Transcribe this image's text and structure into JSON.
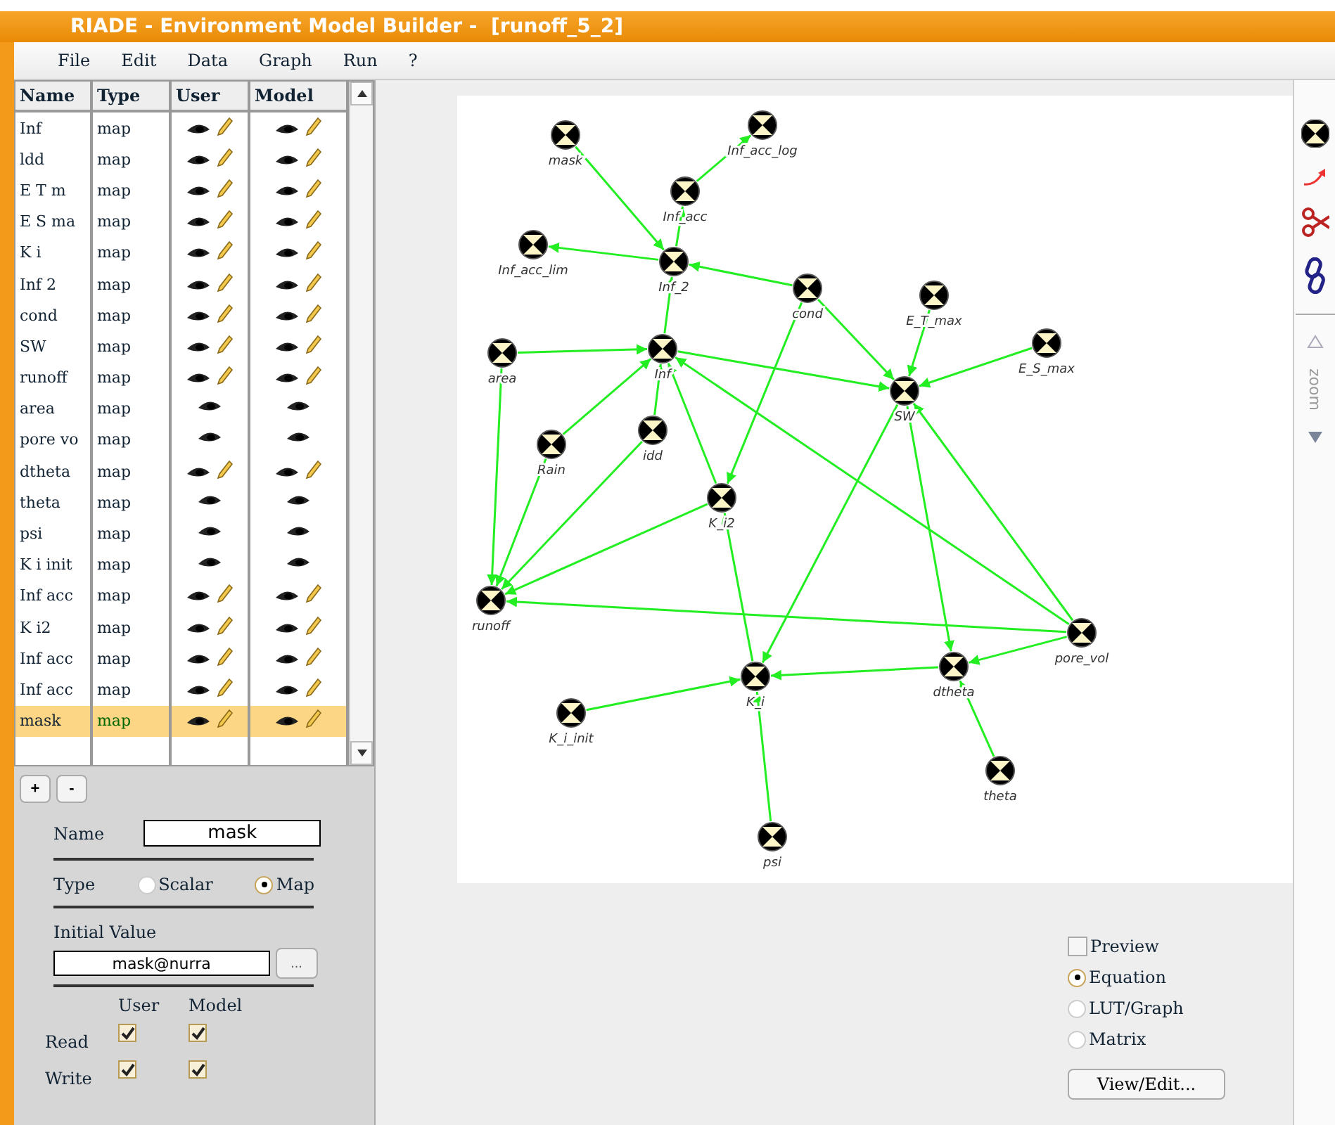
{
  "window": {
    "title": "RIADE - Environment Model Builder -  [runoff_5_2]"
  },
  "menu": [
    "File",
    "Edit",
    "Data",
    "Graph",
    "Run",
    "?"
  ],
  "variables": {
    "columns": [
      "Name",
      "Type",
      "User",
      "Model"
    ],
    "rows": [
      {
        "name": "Inf",
        "type": "map",
        "user_read": true,
        "user_write": true,
        "model_read": true,
        "model_write": true,
        "selected": false
      },
      {
        "name": "ldd",
        "type": "map",
        "user_read": true,
        "user_write": true,
        "model_read": true,
        "model_write": true,
        "selected": false
      },
      {
        "name": "E T m",
        "type": "map",
        "user_read": true,
        "user_write": true,
        "model_read": true,
        "model_write": true,
        "selected": false
      },
      {
        "name": "E S ma",
        "type": "map",
        "user_read": true,
        "user_write": true,
        "model_read": true,
        "model_write": true,
        "selected": false
      },
      {
        "name": "K i",
        "type": "map",
        "user_read": true,
        "user_write": true,
        "model_read": true,
        "model_write": true,
        "selected": false
      },
      {
        "name": "Inf 2",
        "type": "map",
        "user_read": true,
        "user_write": true,
        "model_read": true,
        "model_write": true,
        "selected": false
      },
      {
        "name": "cond",
        "type": "map",
        "user_read": true,
        "user_write": true,
        "model_read": true,
        "model_write": true,
        "selected": false
      },
      {
        "name": "SW",
        "type": "map",
        "user_read": true,
        "user_write": true,
        "model_read": true,
        "model_write": true,
        "selected": false
      },
      {
        "name": "runoff",
        "type": "map",
        "user_read": true,
        "user_write": true,
        "model_read": true,
        "model_write": true,
        "selected": false
      },
      {
        "name": "area",
        "type": "map",
        "user_read": true,
        "user_write": false,
        "model_read": true,
        "model_write": false,
        "selected": false
      },
      {
        "name": "pore vo",
        "type": "map",
        "user_read": true,
        "user_write": false,
        "model_read": true,
        "model_write": false,
        "selected": false
      },
      {
        "name": "dtheta",
        "type": "map",
        "user_read": true,
        "user_write": true,
        "model_read": true,
        "model_write": true,
        "selected": false
      },
      {
        "name": "theta",
        "type": "map",
        "user_read": true,
        "user_write": false,
        "model_read": true,
        "model_write": false,
        "selected": false
      },
      {
        "name": "psi",
        "type": "map",
        "user_read": true,
        "user_write": false,
        "model_read": true,
        "model_write": false,
        "selected": false
      },
      {
        "name": "K i init",
        "type": "map",
        "user_read": true,
        "user_write": false,
        "model_read": true,
        "model_write": false,
        "selected": false
      },
      {
        "name": "Inf acc",
        "type": "map",
        "user_read": true,
        "user_write": true,
        "model_read": true,
        "model_write": true,
        "selected": false
      },
      {
        "name": "K i2",
        "type": "map",
        "user_read": true,
        "user_write": true,
        "model_read": true,
        "model_write": true,
        "selected": false
      },
      {
        "name": "Inf acc",
        "type": "map",
        "user_read": true,
        "user_write": true,
        "model_read": true,
        "model_write": true,
        "selected": false
      },
      {
        "name": "Inf acc",
        "type": "map",
        "user_read": true,
        "user_write": true,
        "model_read": true,
        "model_write": true,
        "selected": false
      },
      {
        "name": "mask",
        "type": "map",
        "user_read": true,
        "user_write": true,
        "model_read": true,
        "model_write": true,
        "selected": true
      }
    ]
  },
  "list_buttons": [
    "+",
    "-"
  ],
  "editor": {
    "name_label": "Name",
    "name_value": "mask",
    "type_label": "Type",
    "type_options": [
      {
        "label": "Scalar",
        "selected": false
      },
      {
        "label": "Map",
        "selected": true
      }
    ],
    "initial_value_label": "Initial Value",
    "initial_value": "mask@nurra",
    "browse_button": "...",
    "permission_columns": [
      "User",
      "Model"
    ],
    "permissions": [
      {
        "label": "Read",
        "user": true,
        "model": true
      },
      {
        "label": "Write",
        "user": true,
        "model": true
      }
    ]
  },
  "graph": {
    "nodes": [
      {
        "label": "mask"
      },
      {
        "label": "Inf_acc_log"
      },
      {
        "label": "Inf_acc"
      },
      {
        "label": "Inf_acc_lim"
      },
      {
        "label": "Inf_2"
      },
      {
        "label": "cond"
      },
      {
        "label": "E_T_max"
      },
      {
        "label": "E_S_max"
      },
      {
        "label": "area"
      },
      {
        "label": "Inf"
      },
      {
        "label": "SW"
      },
      {
        "label": "idd"
      },
      {
        "label": "Rain"
      },
      {
        "label": "K_i2"
      },
      {
        "label": "runoff"
      },
      {
        "label": "pore_vol"
      },
      {
        "label": "dtheta"
      },
      {
        "label": "K_i"
      },
      {
        "label": "K_i_init"
      },
      {
        "label": "theta"
      },
      {
        "label": "psi"
      }
    ]
  },
  "toolbar": {
    "zoom_label": "zoom"
  },
  "view_options": {
    "preview": {
      "label": "Preview",
      "checked": false
    },
    "modes": [
      {
        "label": "Equation",
        "selected": true
      },
      {
        "label": "LUT/Graph",
        "selected": false
      },
      {
        "label": "Matrix",
        "selected": false
      }
    ],
    "view_button": "View/Edit..."
  }
}
